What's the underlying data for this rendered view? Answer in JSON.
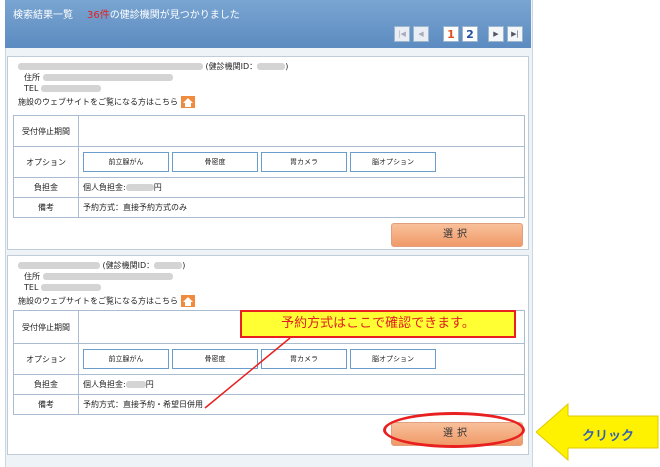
{
  "header": {
    "title": "検索結果一覧",
    "count_text": "36件",
    "title_suffix": "の健診機関が見つかりました"
  },
  "pager": {
    "first": "|◀",
    "prev": "◀",
    "page_current": "1",
    "page_next": "2",
    "next": "▶",
    "last": "▶|"
  },
  "cards": [
    {
      "facility_id_label": "(健診機関ID：",
      "facility_id_close": ")",
      "address_label": "住所",
      "tel_label": "TEL",
      "website_text": "施設のウェブサイトをご覧になる方はこちら",
      "rows": {
        "stop_label": "受付停止期間",
        "option_label": "オプション",
        "options": [
          "前立腺がん",
          "骨密度",
          "胃カメラ",
          "脳オプション"
        ],
        "burden_label": "負担金",
        "burden_value_prefix": "個人負担金:",
        "burden_value_suffix": "円",
        "remarks_label": "備考",
        "remarks_value": "予約方式：直接予約方式のみ"
      },
      "select_label": "選択"
    },
    {
      "facility_id_label": "(健診機関ID：",
      "facility_id_close": ")",
      "address_label": "住所",
      "tel_label": "TEL",
      "website_text": "施設のウェブサイトをご覧になる方はこちら",
      "rows": {
        "stop_label": "受付停止期間",
        "option_label": "オプション",
        "options": [
          "前立腺がん",
          "骨密度",
          "胃カメラ",
          "脳オプション"
        ],
        "burden_label": "負担金",
        "burden_value_prefix": "個人負担金:",
        "burden_value_suffix": "円",
        "remarks_label": "備考",
        "remarks_value": "予約方式：直接予約・希望日併用"
      },
      "select_label": "選択"
    }
  ],
  "annotation": {
    "callout": "予約方式はここで確認できます。",
    "click_label": "クリック"
  }
}
